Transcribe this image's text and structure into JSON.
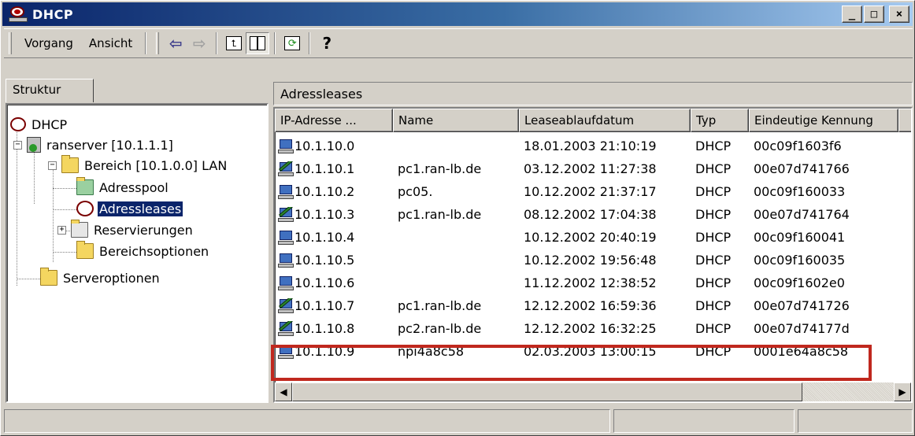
{
  "window": {
    "title": "DHCP",
    "buttons": {
      "minimize": "_",
      "maximize": "□",
      "close": "×"
    }
  },
  "menu": {
    "items": [
      {
        "label": "Vorgang"
      },
      {
        "label": "Ansicht"
      }
    ]
  },
  "left": {
    "tab_label": "Struktur",
    "tree": [
      {
        "label": "DHCP",
        "icon": "dhcp-icon"
      },
      {
        "label": "ranserver [10.1.1.1]",
        "icon": "server-icon"
      },
      {
        "label": "Bereich [10.1.0.0] LAN",
        "icon": "folder-icon"
      },
      {
        "label": "Adresspool",
        "icon": "pool-icon"
      },
      {
        "label": "Adressleases",
        "icon": "leases-icon",
        "selected": true
      },
      {
        "label": "Reservierungen",
        "icon": "reservations-icon"
      },
      {
        "label": "Bereichsoptionen",
        "icon": "options-icon"
      },
      {
        "label": "Serveroptionen",
        "icon": "server-options-icon"
      }
    ]
  },
  "right": {
    "header": "Adressleases",
    "columns": [
      "IP-Adresse ...",
      "Name",
      "Leaseablaufdatum",
      "Typ",
      "Eindeutige Kennung"
    ],
    "rows": [
      {
        "ip": "10.1.10.0",
        "name": "",
        "expires": "18.01.2003 21:10:19",
        "type": "DHCP",
        "id": "00c09f1603f6",
        "icon": "lease-icon"
      },
      {
        "ip": "10.1.10.1",
        "name": "pc1.ran-lb.de",
        "expires": "03.12.2002 11:27:38",
        "type": "DHCP",
        "id": "00e07d741766",
        "icon": "expired-lease-icon"
      },
      {
        "ip": "10.1.10.2",
        "name": "pc05.",
        "expires": "10.12.2002 21:37:17",
        "type": "DHCP",
        "id": "00c09f160033",
        "icon": "lease-icon"
      },
      {
        "ip": "10.1.10.3",
        "name": "pc1.ran-lb.de",
        "expires": "08.12.2002 17:04:38",
        "type": "DHCP",
        "id": "00e07d741764",
        "icon": "expired-lease-icon"
      },
      {
        "ip": "10.1.10.4",
        "name": "",
        "expires": "10.12.2002 20:40:19",
        "type": "DHCP",
        "id": "00c09f160041",
        "icon": "lease-icon"
      },
      {
        "ip": "10.1.10.5",
        "name": "",
        "expires": "10.12.2002 19:56:48",
        "type": "DHCP",
        "id": "00c09f160035",
        "icon": "lease-icon"
      },
      {
        "ip": "10.1.10.6",
        "name": "",
        "expires": "11.12.2002 12:38:52",
        "type": "DHCP",
        "id": "00c09f1602e0",
        "icon": "lease-icon"
      },
      {
        "ip": "10.1.10.7",
        "name": "pc1.ran-lb.de",
        "expires": "12.12.2002 16:59:36",
        "type": "DHCP",
        "id": "00e07d741726",
        "icon": "expired-lease-icon"
      },
      {
        "ip": "10.1.10.8",
        "name": "pc2.ran-lb.de",
        "expires": "12.12.2002 16:32:25",
        "type": "DHCP",
        "id": "00e07d74177d",
        "icon": "expired-lease-icon"
      },
      {
        "ip": "10.1.10.9",
        "name": "npi4a8c58",
        "expires": "02.03.2003 13:00:15",
        "type": "DHCP",
        "id": "0001e64a8c58",
        "icon": "computer-icon",
        "highlighted": true
      }
    ]
  },
  "colors": {
    "highlight": "#c0281e",
    "selection": "#0a246a",
    "titlebar": "#0a246a"
  }
}
